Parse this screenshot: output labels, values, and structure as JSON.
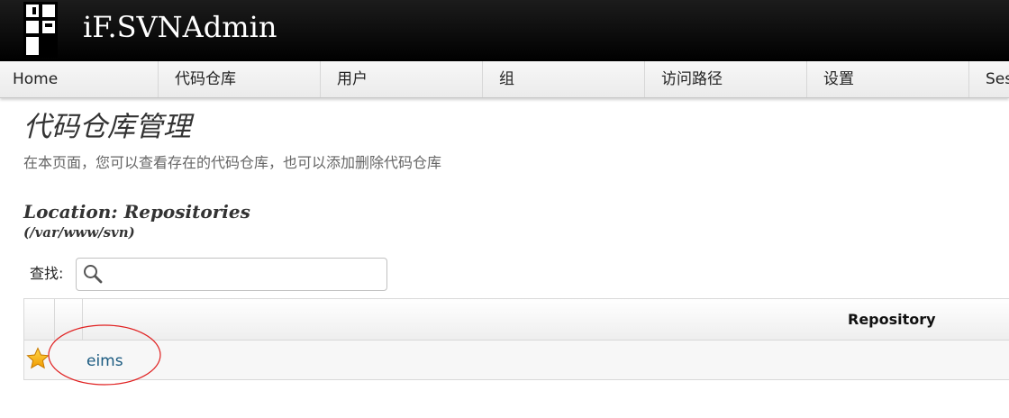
{
  "app": {
    "title": "iF.SVNAdmin"
  },
  "nav": {
    "items": [
      {
        "label": "Home"
      },
      {
        "label": "代码仓库"
      },
      {
        "label": "用户"
      },
      {
        "label": "组"
      },
      {
        "label": "访问路径"
      },
      {
        "label": "设置"
      },
      {
        "label": "Ses"
      }
    ]
  },
  "page": {
    "title": "代码仓库管理",
    "description": "在本页面，您可以查看存在的代码仓库，也可以添加删除代码仓库"
  },
  "location": {
    "label": "Location: Repositories",
    "path": "(/var/www/svn)"
  },
  "search": {
    "label": "查找:",
    "value": "",
    "icon": "search-icon"
  },
  "table": {
    "columns": [
      "",
      "",
      "Repository"
    ],
    "rows": [
      {
        "icon": "star-icon",
        "name": "eims"
      }
    ]
  },
  "colors": {
    "header_bg": "#000000",
    "link": "#1a5a80",
    "annotation": "#e02020",
    "star": "#f5b400"
  }
}
